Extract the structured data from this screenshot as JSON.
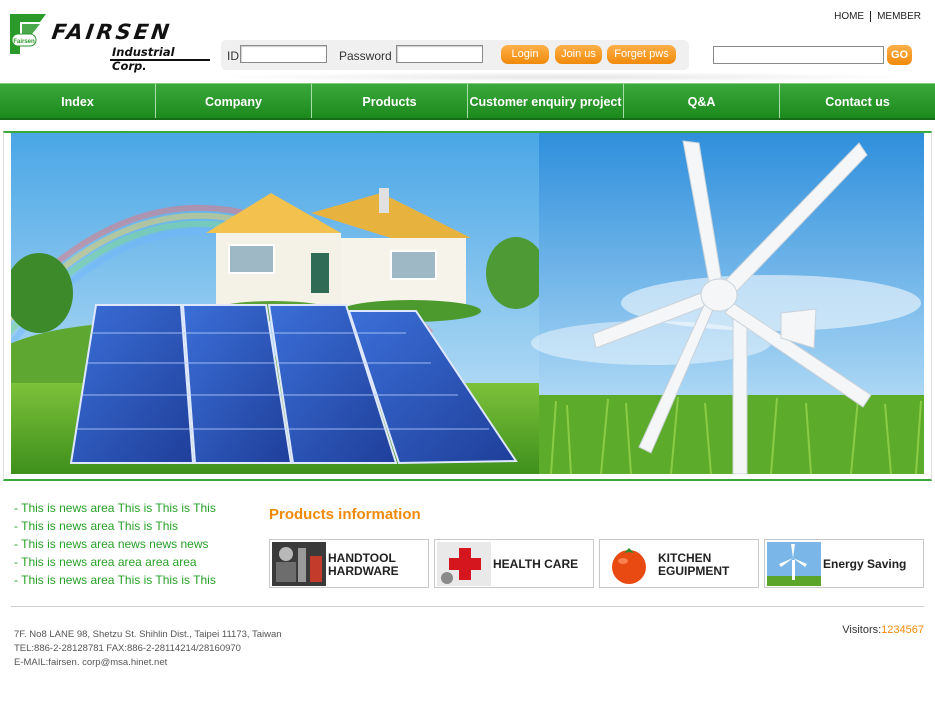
{
  "brand": {
    "name": "FAIRSEN",
    "subtitle": "Industrial Corp.",
    "mark_text": "Fairsen",
    "colors": {
      "green": "#2b9a2b",
      "orange": "#f08a0a"
    }
  },
  "top_links": {
    "home": "HOME",
    "member": "MEMBER"
  },
  "login": {
    "id_label": "ID",
    "id_value": "",
    "password_label": "Password",
    "password_value": "",
    "login_button": "Login",
    "join_button": "Join us",
    "forget_button": "Forget pws"
  },
  "search": {
    "value": "",
    "button": "GO"
  },
  "nav": {
    "items": [
      {
        "label": "Index"
      },
      {
        "label": "Company"
      },
      {
        "label": "Products"
      },
      {
        "label": "Customer enquiry project"
      },
      {
        "label": "Q&A"
      },
      {
        "label": "Contact us"
      }
    ]
  },
  "news": {
    "items": [
      "- This is news area This is This is This",
      "- This is news area This is This",
      "- This is news area  news news news",
      "- This is news area area area area",
      "- This is news area This is This is This"
    ]
  },
  "products": {
    "title": "Products information",
    "cards": [
      {
        "line1": "HANDTOOL",
        "line2": "HARDWARE",
        "icon": "handtool-icon"
      },
      {
        "line1": "HEALTH CARE",
        "line2": "",
        "icon": "health-cross-icon"
      },
      {
        "line1": "KITCHEN",
        "line2": "EGUIPMENT",
        "icon": "tomato-icon"
      },
      {
        "line1": "Energy Saving",
        "line2": "",
        "icon": "wind-turbine-icon"
      }
    ]
  },
  "footer": {
    "address": "7F. No8 LANE 98, Shetzu St. Shihlin Dist., Taipei 11173, Taiwan",
    "phone": "TEL:886-2-28128781 FAX:886-2-28114214/28160970",
    "email": "E-MAIL:fairsen. corp@msa.hinet.net",
    "visitors_label": "Visitors:",
    "visitors_count": "1234567"
  }
}
